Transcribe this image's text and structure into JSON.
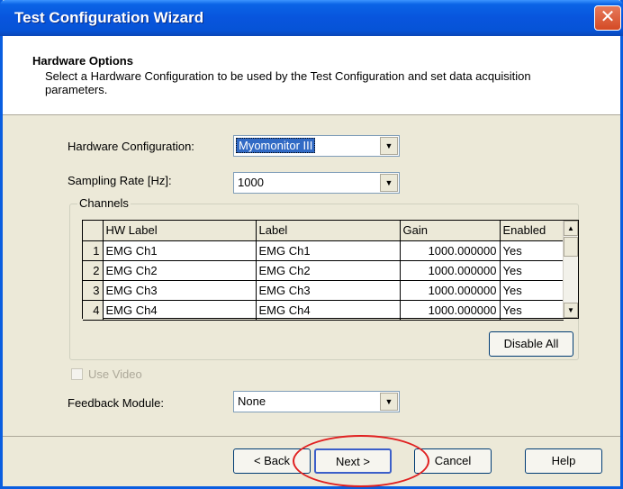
{
  "window": {
    "title": "Test Configuration Wizard"
  },
  "header": {
    "title": "Hardware Options",
    "description": "Select a Hardware Configuration to be used by the Test Configuration and set data acquisition parameters."
  },
  "hardware_configuration": {
    "label": "Hardware Configuration:",
    "value": "Myomonitor III"
  },
  "sampling_rate": {
    "label": "Sampling Rate [Hz]:",
    "value": "1000"
  },
  "channels": {
    "title": "Channels",
    "columns": [
      "HW Label",
      "Label",
      "Gain",
      "Enabled"
    ],
    "rows": [
      {
        "index": "1",
        "hw_label": "EMG Ch1",
        "label": "EMG Ch1",
        "gain": "1000.000000",
        "enabled": "Yes"
      },
      {
        "index": "2",
        "hw_label": "EMG Ch2",
        "label": "EMG Ch2",
        "gain": "1000.000000",
        "enabled": "Yes"
      },
      {
        "index": "3",
        "hw_label": "EMG Ch3",
        "label": "EMG Ch3",
        "gain": "1000.000000",
        "enabled": "Yes"
      },
      {
        "index": "4",
        "hw_label": "EMG Ch4",
        "label": "EMG Ch4",
        "gain": "1000.000000",
        "enabled": "Yes"
      }
    ],
    "disable_all_label": "Disable All"
  },
  "use_video": {
    "label": "Use Video",
    "checked": false
  },
  "feedback_module": {
    "label": "Feedback Module:",
    "value": "None"
  },
  "buttons": {
    "back": "< Back",
    "next": "Next >",
    "cancel": "Cancel",
    "help": "Help"
  },
  "colors": {
    "title_bar": "#0855dd",
    "dialog_bg": "#ece9d8",
    "highlight": "#316ac5",
    "annotation": "#e02020"
  }
}
